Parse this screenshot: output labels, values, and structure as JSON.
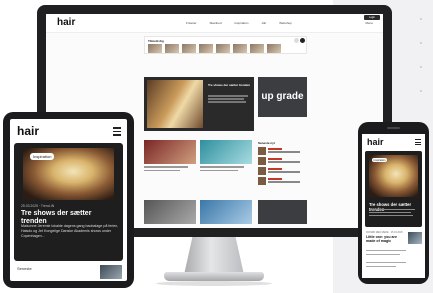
{
  "monitor": {
    "logo": "hair",
    "nav_links": [
      "Frisører",
      "Skønhed",
      "Inspiration",
      "Job",
      "Webshop"
    ],
    "menu": "Menu",
    "top_pill": "Login",
    "subscribe_title": "Tilmeld dig",
    "hero_title": "Tre shows der sætter trenden",
    "upgrade_logo": "up grade",
    "sidebar_title": "Seneste nyt"
  },
  "tablet": {
    "logo": "hair",
    "badge": "Inspiration",
    "date": "25.03.2025 · Trend-IN",
    "title": "Tre shows der sætter trenden",
    "excerpt": "Maisonne Jeremie lokalde dagens gang baobalage på ferien, Haisdo og Jet Kongelige Danske Akademis shows under Copenhagen...",
    "bottom_label": "Seneste"
  },
  "phone": {
    "logo": "hair",
    "badge": "Inspiration",
    "title": "Tre shows der sætter trenden",
    "category": "FRISØR MED MERE · 25.03.2025",
    "secondary_title": "Little one: you are made of magic"
  }
}
